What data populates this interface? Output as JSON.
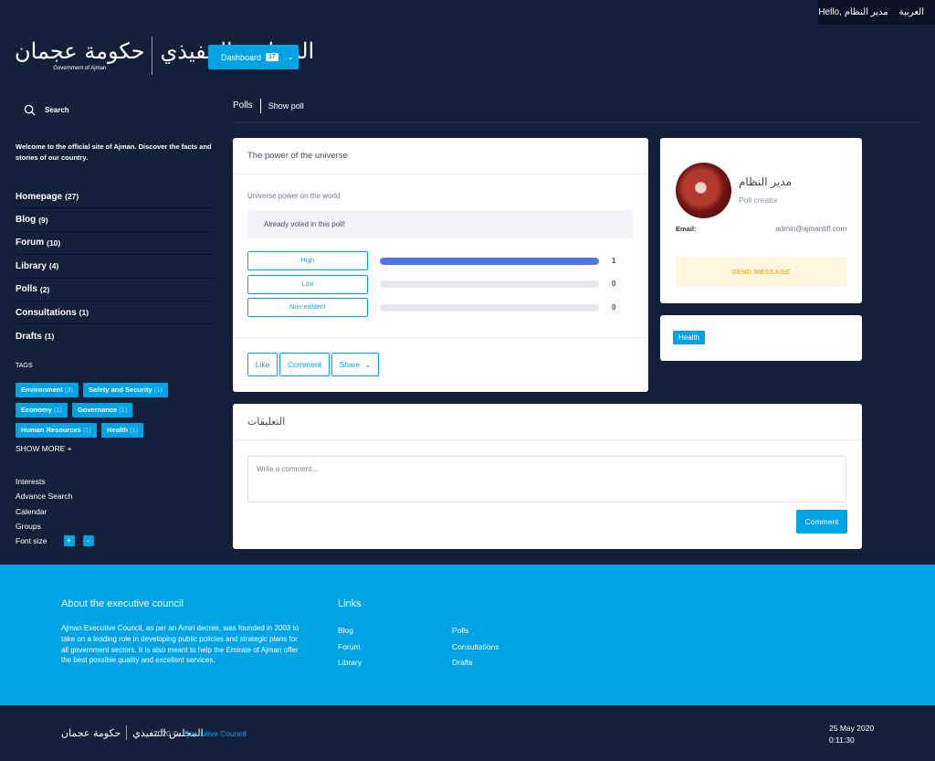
{
  "topbar": {
    "greeting": "Hello, مدير النظام",
    "language": "العربية"
  },
  "logo": {
    "left_arabic": "حكومة عجمان",
    "left_sub": "Government of Ajman",
    "right_arabic": "المجلس التنفيذي",
    "right_sub": "Executive Council"
  },
  "dashboard": {
    "label": "Dashboard",
    "badge": "17"
  },
  "sidebar": {
    "search_label": "Search",
    "welcome": "Welcome to the official site of Ajman. Discover the facts and stories of our country.",
    "nav": [
      {
        "label": "Homepage",
        "count": "(27)"
      },
      {
        "label": "Blog",
        "count": "(9)"
      },
      {
        "label": "Forum",
        "count": "(10)"
      },
      {
        "label": "Library",
        "count": "(4)"
      },
      {
        "label": "Polls",
        "count": "(2)"
      },
      {
        "label": "Consultations",
        "count": "(1)"
      },
      {
        "label": "Drafts",
        "count": "(1)"
      }
    ],
    "tags_title": "TAGS",
    "tags": [
      {
        "label": "Environment",
        "count": "(3)"
      },
      {
        "label": "Safety and Security",
        "count": "(1)"
      },
      {
        "label": "Economy",
        "count": "(1)"
      },
      {
        "label": "Governance",
        "count": "(1)"
      },
      {
        "label": "Human Resources",
        "count": "(1)"
      },
      {
        "label": "Health",
        "count": "(1)"
      }
    ],
    "show_more": "SHOW MORE +",
    "links": [
      "Interests",
      "Advance Search",
      "Calendar",
      "Groups"
    ],
    "font_size": {
      "label": "Font size",
      "plus": "+",
      "minus": "-"
    }
  },
  "breadcrumb": {
    "first": "Polls",
    "second": "Show poll"
  },
  "poll": {
    "title": "The power of the universe",
    "question": "Universe power on the world",
    "voted_msg": "Already voted in this poll!",
    "options": [
      {
        "label": "High",
        "votes": "1",
        "fraction": 1
      },
      {
        "label": "Low",
        "votes": "0",
        "fraction": 0
      },
      {
        "label": "Non-existent",
        "votes": "0",
        "fraction": 0
      }
    ],
    "actions": {
      "like": "Like",
      "comment": "Comment",
      "share": "Share"
    }
  },
  "profile": {
    "name": "مدير النظام",
    "role": "Poll creator",
    "email_label": "Email:",
    "email": "admin@ajmanbfl.com",
    "send_label": "SEND MESSAGE"
  },
  "tag_card": {
    "tag": "Health"
  },
  "comments": {
    "title": "التعليقات",
    "placeholder": "Write a comment...",
    "button": "Comment"
  },
  "footer": {
    "about_title": "About the executive council",
    "about_text": "Ajman Executive Council, as per an Amiri decree, was founded in 2003 to take on a leading role in developing public policies and strategic plans for all government sectors. It is also meant to help the Emirate of Ajman offer the best possible quality and excellent services.",
    "links_title": "Links",
    "links_col1": [
      "Blog",
      "Forum",
      "Library"
    ],
    "links_col2": [
      "Polls",
      "Consultations",
      "Drafts"
    ]
  },
  "bottom": {
    "copyright": "2020 ©",
    "org": "Executive Council",
    "date": "25 May 2020",
    "time": "0:11:30"
  },
  "colors": {
    "accent": "#00a3e6",
    "bg": "#13203a",
    "bar": "#5076e4",
    "send_text": "#f2b634"
  }
}
